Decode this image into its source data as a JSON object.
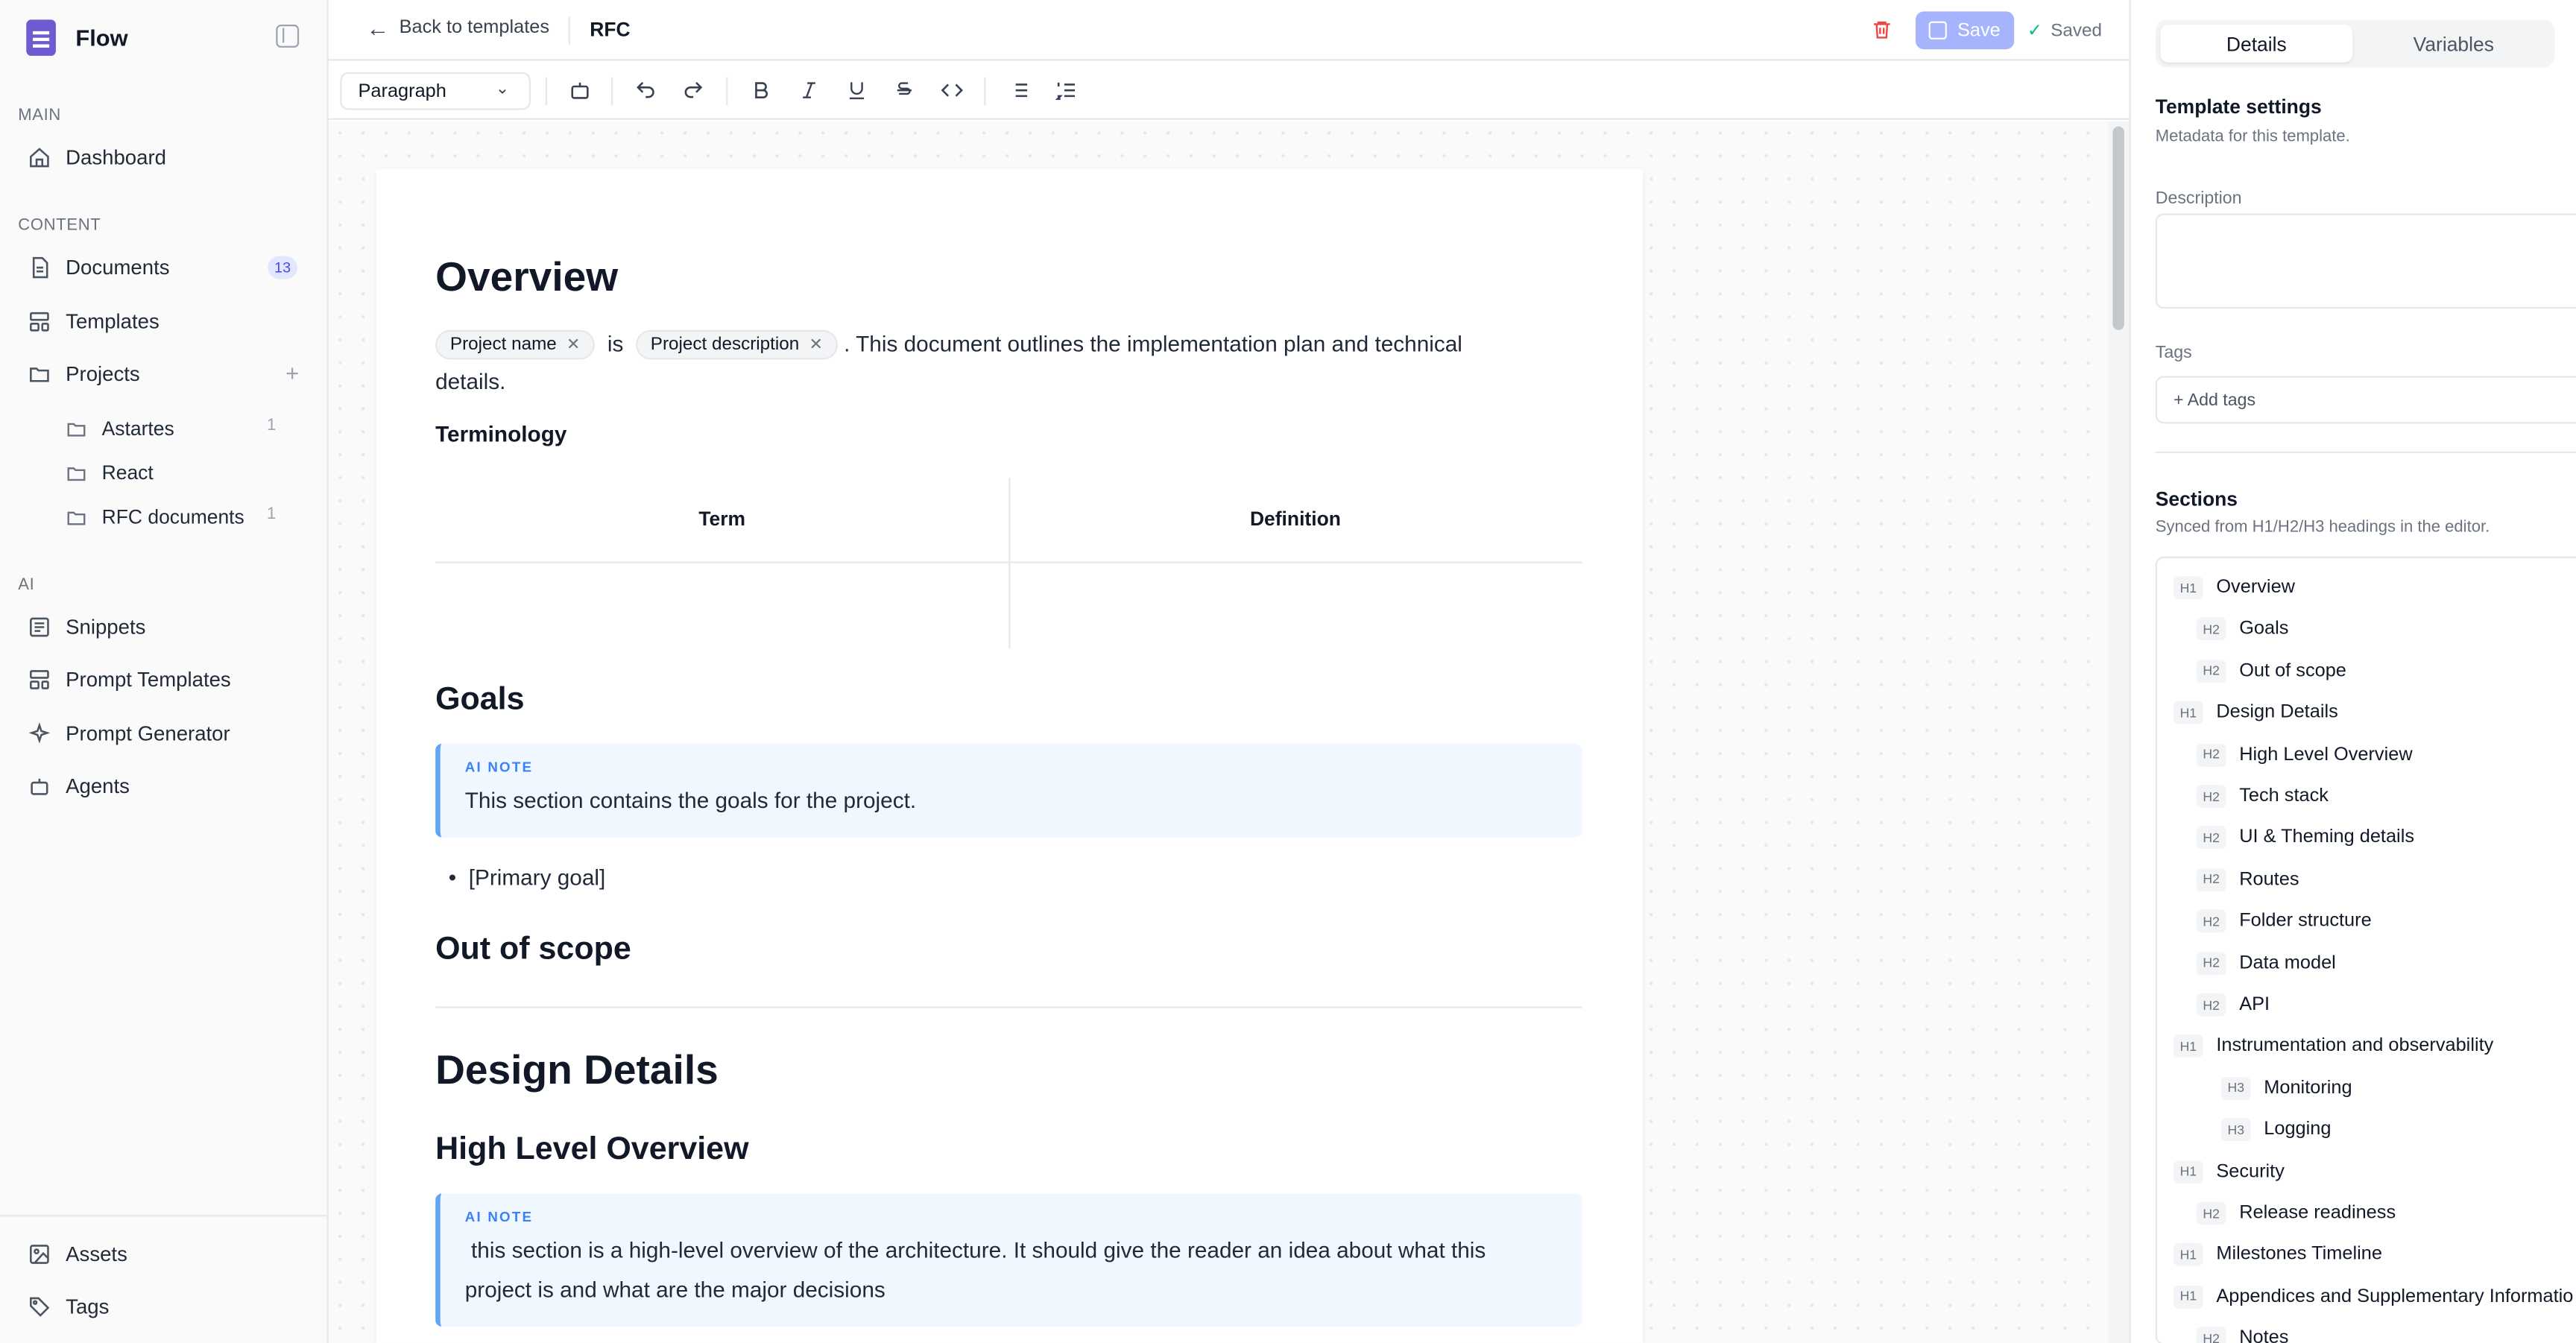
{
  "app": {
    "name": "Flow"
  },
  "sidebar": {
    "sections": {
      "main": "MAIN",
      "content": "CONTENT",
      "ai": "AI"
    },
    "main_items": [
      {
        "label": "Dashboard",
        "icon": "home-icon"
      }
    ],
    "content_items": [
      {
        "label": "Documents",
        "icon": "document-icon",
        "badge": "13"
      },
      {
        "label": "Templates",
        "icon": "layout-icon"
      },
      {
        "label": "Projects",
        "icon": "folder-icon"
      }
    ],
    "projects": [
      {
        "label": "Astartes",
        "count": "1"
      },
      {
        "label": "React",
        "count": ""
      },
      {
        "label": "RFC documents",
        "count": "1"
      }
    ],
    "ai_items": [
      {
        "label": "Snippets",
        "icon": "snippet-icon"
      },
      {
        "label": "Prompt Templates",
        "icon": "layout-icon"
      },
      {
        "label": "Prompt Generator",
        "icon": "sparkles-icon"
      },
      {
        "label": "Agents",
        "icon": "bot-icon"
      }
    ],
    "footer_items": [
      {
        "label": "Assets",
        "icon": "image-icon"
      },
      {
        "label": "Tags",
        "icon": "tag-icon"
      }
    ]
  },
  "header": {
    "back_label": "Back to templates",
    "title": "RFC",
    "save_label": "Save",
    "saved_label": "Saved"
  },
  "toolbar": {
    "block_type": "Paragraph"
  },
  "editor": {
    "overview_heading": "Overview",
    "chip1": "Project name",
    "is_word": "is",
    "chip2": "Project description",
    "overview_text_line1": ". This document outlines the implementation plan and technical",
    "overview_text_line2": "details.",
    "terminology_heading": "Terminology",
    "table": {
      "headers": [
        "Term",
        "Definition"
      ]
    },
    "goals_heading": "Goals",
    "ai_note_label": "AI NOTE",
    "goals_note": "This section contains the goals for the project.",
    "goal_bullet": "[Primary goal]",
    "out_of_scope_heading": "Out of scope",
    "design_heading": "Design Details",
    "hlo_heading": "High Level Overview",
    "hlo_note_line1": " this section is a high-level overview of the architecture. It should give the reader an idea about what this",
    "hlo_note_line2": "project is and what are the major decisions"
  },
  "right_panel": {
    "tabs": [
      "Details",
      "Variables"
    ],
    "settings_title": "Template settings",
    "settings_sub": "Metadata for this template.",
    "description_label": "Description",
    "tags_label": "Tags",
    "add_tags": "+ Add tags",
    "sections_title": "Sections",
    "sections_sub": "Synced from H1/H2/H3 headings in the editor.",
    "sections": [
      {
        "level": "H1",
        "label": "Overview"
      },
      {
        "level": "H2",
        "label": "Goals"
      },
      {
        "level": "H2",
        "label": "Out of scope"
      },
      {
        "level": "H1",
        "label": "Design Details"
      },
      {
        "level": "H2",
        "label": "High Level Overview"
      },
      {
        "level": "H2",
        "label": "Tech stack"
      },
      {
        "level": "H2",
        "label": "UI & Theming details"
      },
      {
        "level": "H2",
        "label": "Routes"
      },
      {
        "level": "H2",
        "label": "Folder structure"
      },
      {
        "level": "H2",
        "label": "Data model"
      },
      {
        "level": "H2",
        "label": "API"
      },
      {
        "level": "H1",
        "label": "Instrumentation and observability"
      },
      {
        "level": "H3",
        "label": "Monitoring"
      },
      {
        "level": "H3",
        "label": "Logging"
      },
      {
        "level": "H1",
        "label": "Security"
      },
      {
        "level": "H2",
        "label": "Release readiness"
      },
      {
        "level": "H1",
        "label": "Milestones Timeline"
      },
      {
        "level": "H1",
        "label": "Appendices and Supplementary Informatio"
      },
      {
        "level": "H2",
        "label": "Notes"
      }
    ]
  },
  "colors": {
    "accent": "#6d5bd0",
    "save_button": "#a5b4fc",
    "ai_note_border": "#60a5fa",
    "delete": "#ef4444"
  }
}
